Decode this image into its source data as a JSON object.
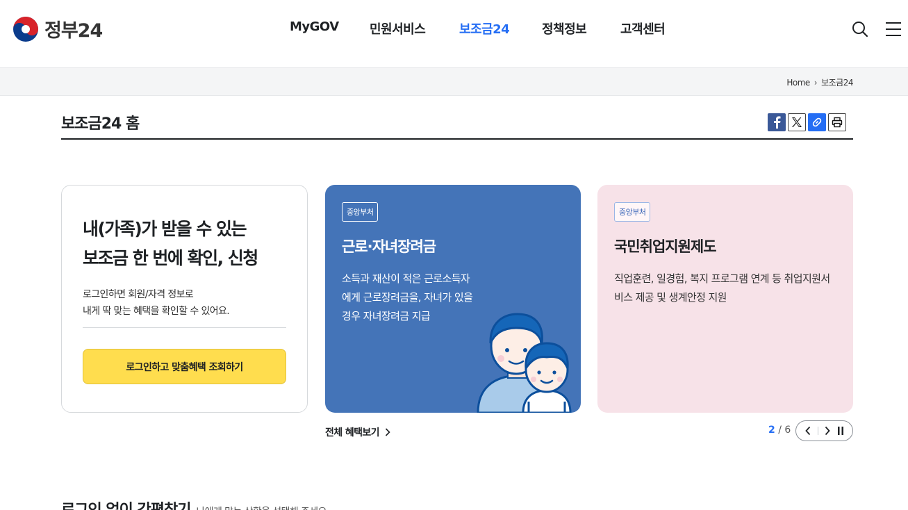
{
  "header": {
    "logo_text": "정부24",
    "nav": [
      {
        "label": "MyGOV",
        "active": false
      },
      {
        "label": "민원서비스",
        "active": false
      },
      {
        "label": "보조금24",
        "active": true
      },
      {
        "label": "정책정보",
        "active": false
      },
      {
        "label": "고객센터",
        "active": false
      }
    ]
  },
  "breadcrumb": {
    "home": "Home",
    "current": "보조금24"
  },
  "page_title": "보조금24 홈",
  "share": [
    "facebook-icon",
    "x-icon",
    "link-icon",
    "print-icon"
  ],
  "login_card": {
    "headline_1": "내(가족)가 받을 수 있는",
    "headline_2": "보조금 한 번에 확인, 신청",
    "desc_1": "로그인하면 회원/자격 정보로",
    "desc_2": "내게 딱 맞는 혜택을 확인할 수 있어요.",
    "button": "로그인하고 맞춤혜택 조회하기"
  },
  "benefit_cards": [
    {
      "tag": "중앙부처",
      "title": "근로·자녀장려금",
      "desc": "소득과 재산이 적은 근로소득자에게 근로장려금을, 자녀가 있을 경우 자녀장려금 지급",
      "bg": "#4474b8"
    },
    {
      "tag": "중앙부처",
      "title": "국민취업지원제도",
      "desc": "직업훈련, 일경험, 복지 프로그램 연계 등 취업지원서비스 제공 및 생계안정 지원",
      "bg": "#f7e2e8"
    }
  ],
  "all_benefits_link": "전체 혜택보기",
  "pager": {
    "current": "2",
    "separator": "/",
    "total": "6"
  },
  "section2": {
    "title": "로그인 없이 간편찾기",
    "subtitle": "나에게 맞는 상황을 선택해 주세요."
  },
  "colors": {
    "accent": "#256ef4",
    "button_yellow": "#ffdd4e"
  }
}
